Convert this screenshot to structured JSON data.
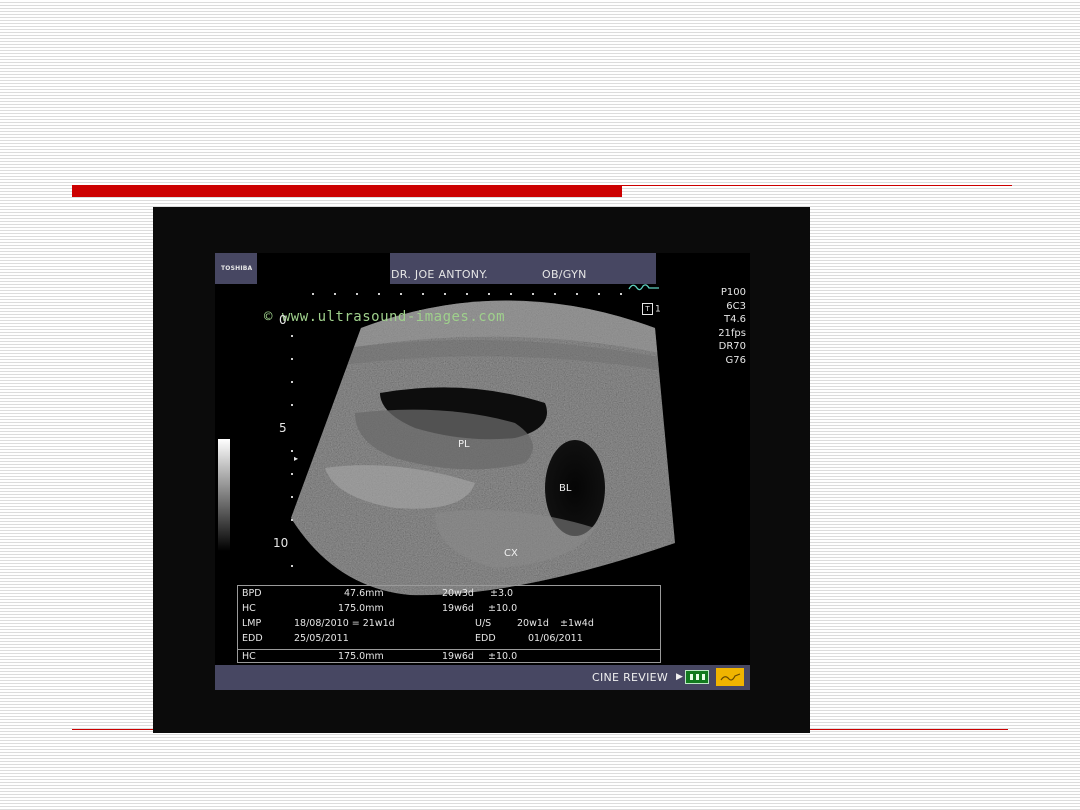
{
  "device": {
    "brand": "TOSHIBA",
    "doctor": "DR. JOE ANTONY.",
    "department": "OB/GYN",
    "params": [
      "P100",
      "6C3",
      "T4.6",
      "21fps",
      "DR70",
      "G76"
    ],
    "transducer_tag": "T",
    "transducer_number": "1"
  },
  "watermark": "© www.ultrasound-images.com",
  "depth_scale": {
    "top": "0",
    "mid": "5",
    "bottom": "10",
    "focus_marker": "▸"
  },
  "labels": {
    "placenta": "PL",
    "bladder": "BL",
    "cervix": "CX"
  },
  "measurements": {
    "bpd": {
      "label": "BPD",
      "value": "47.6mm",
      "age": "20w3d",
      "range": "±3.0"
    },
    "hc": {
      "label": "HC",
      "value": "175.0mm",
      "age": "19w6d",
      "range": "±10.0"
    },
    "lmp": {
      "label": "LMP",
      "value": "18/08/2010 = 21w1d",
      "us_label": "U/S",
      "us_age": "20w1d",
      "us_range": "±1w4d"
    },
    "edd": {
      "label": "EDD",
      "value": "25/05/2011",
      "edd2_label": "EDD",
      "edd2_value": "01/06/2011"
    },
    "hc_last": {
      "label": "HC",
      "value": "175.0mm",
      "age": "19w6d",
      "range": "±10.0"
    }
  },
  "footer": {
    "cine_review": "CINE REVIEW",
    "arrow": "▶"
  },
  "colors": {
    "accent_red": "#cc0000",
    "header_bar": "#474762",
    "watermark": "#9fd08c",
    "button_green": "#127a1e",
    "button_yellow": "#f0b400"
  }
}
